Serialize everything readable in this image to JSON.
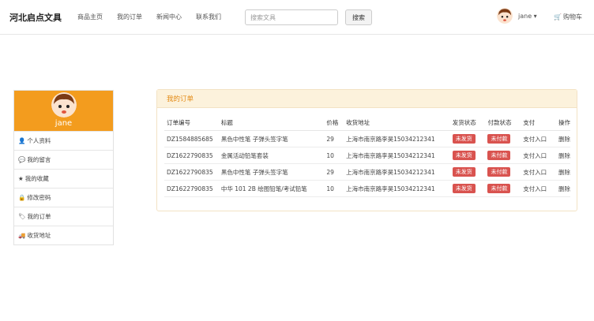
{
  "nav": {
    "brand": "河北启点文具",
    "links": [
      "商品主页",
      "我的订单",
      "新闻中心",
      "联系我们"
    ],
    "search_placeholder": "搜索文具",
    "search_button": "搜索",
    "user": "jane ▾",
    "cart": "购物车"
  },
  "sidebar": {
    "name": "jane",
    "items": [
      {
        "icon": "user-icon",
        "glyph": "👤",
        "label": "个人资料"
      },
      {
        "icon": "comment-icon",
        "glyph": "💬",
        "label": "我的留言"
      },
      {
        "icon": "star-icon",
        "glyph": "★",
        "label": "我的收藏"
      },
      {
        "icon": "lock-icon",
        "glyph": "🔒",
        "label": "修改密码"
      },
      {
        "icon": "tags-icon",
        "glyph": "🏷",
        "label": "我的订单"
      },
      {
        "icon": "truck-icon",
        "glyph": "🚚",
        "label": "收货地址"
      }
    ]
  },
  "orders": {
    "title": "我的订单",
    "headers": [
      "订单编号",
      "标题",
      "价格",
      "收货地址",
      "发货状态",
      "付款状态",
      "支付",
      "操作"
    ],
    "rows": [
      {
        "id": "DZ1584885685",
        "title": "黑色中性笔 子弹头签字笔",
        "price": "29",
        "address": "上海市南京路李昊15034212341",
        "ship": "未发货",
        "pay": "未付款",
        "pay_link": "支付入口",
        "action": "删除"
      },
      {
        "id": "DZ1622790835",
        "title": "金属活动铅笔套装",
        "price": "10",
        "address": "上海市南京路李昊15034212341",
        "ship": "未发货",
        "pay": "未付款",
        "pay_link": "支付入口",
        "action": "删除"
      },
      {
        "id": "DZ1622790835",
        "title": "黑色中性笔 子弹头签字笔",
        "price": "29",
        "address": "上海市南京路李昊15034212341",
        "ship": "未发货",
        "pay": "未付款",
        "pay_link": "支付入口",
        "action": "删除"
      },
      {
        "id": "DZ1622790835",
        "title": "中华 101 2B 绘图铅笔/考试铅笔",
        "price": "10",
        "address": "上海市南京路李昊15034212341",
        "ship": "未发货",
        "pay": "未付款",
        "pay_link": "支付入口",
        "action": "删除"
      }
    ]
  },
  "colors": {
    "accent": "#f39c1e",
    "badge": "#d9534f",
    "panel_head": "#fcf2dc"
  }
}
